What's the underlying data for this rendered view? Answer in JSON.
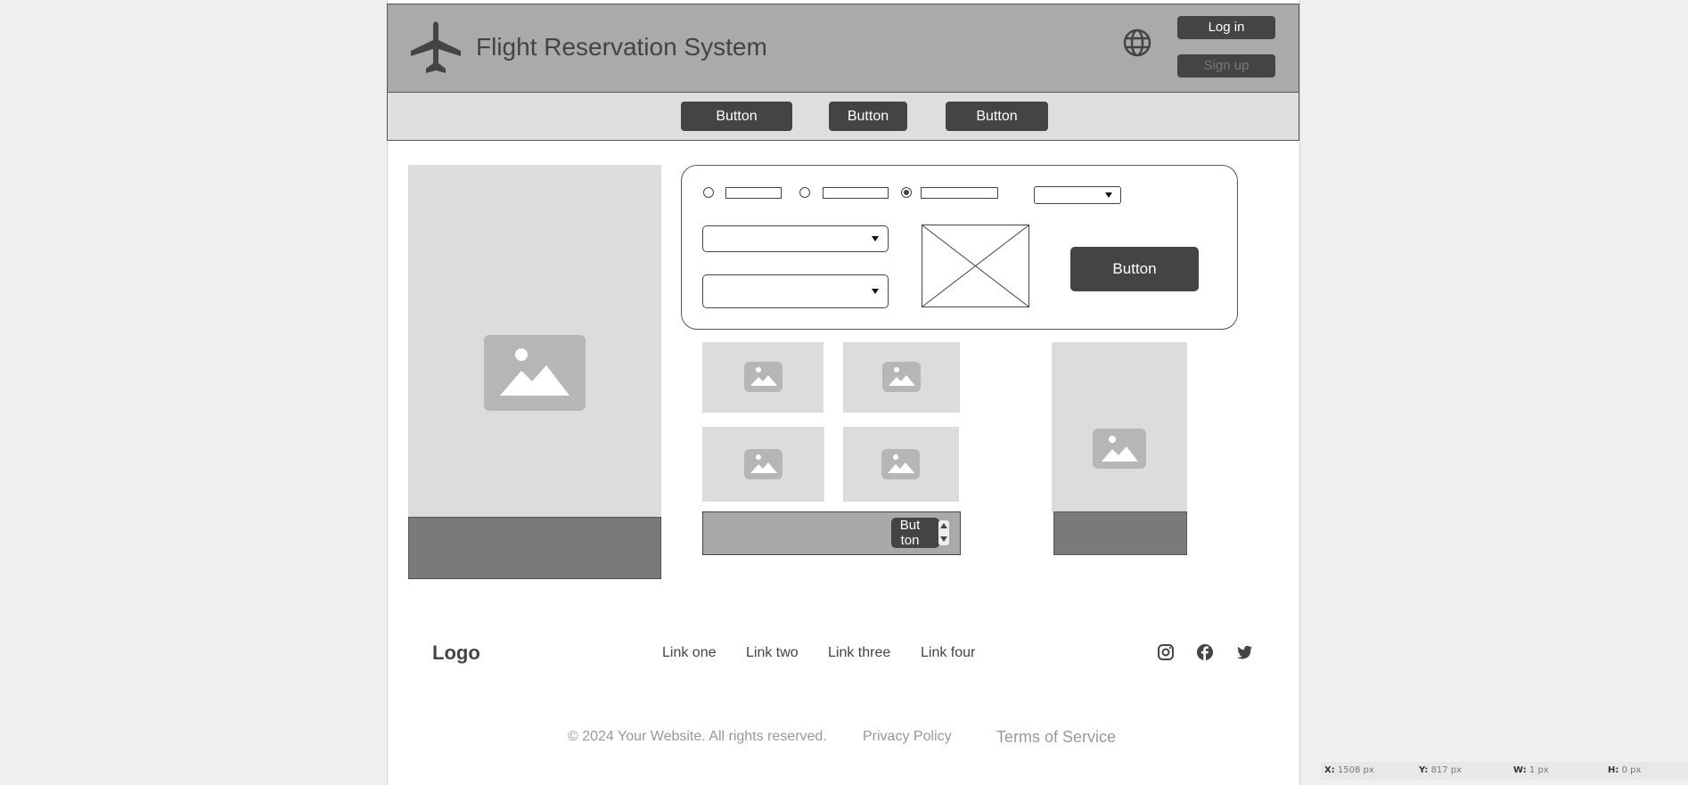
{
  "header": {
    "title": "Flight Reservation System",
    "login_label": "Log in",
    "signup_label": "Sign up"
  },
  "nav": {
    "buttons": [
      "Button",
      "Button",
      "Button"
    ]
  },
  "search_form": {
    "submit_label": "Button"
  },
  "gallery": {
    "step_button_label_1": "But",
    "step_button_label_2": "ton"
  },
  "footer": {
    "logo": "Logo",
    "links": [
      "Link one",
      "Link two",
      "Link three",
      "Link four"
    ],
    "copyright": "© 2024 Your Website. All rights reserved.",
    "privacy": "Privacy Policy",
    "terms": "Terms of Service"
  },
  "status_bar": {
    "x_label": "X:",
    "x_value": "1508 px",
    "y_label": "Y:",
    "y_value": "817 px",
    "w_label": "W:",
    "w_value": "1 px",
    "h_label": "H:",
    "h_value": "0 px"
  },
  "icons": {
    "brand": "airplane-icon",
    "language": "globe-icon",
    "image_placeholder": "image-icon",
    "social": [
      "instagram-icon",
      "facebook-icon",
      "twitter-icon"
    ]
  },
  "colors": {
    "header_bg": "#aaaaaa",
    "nav_bg": "#dedede",
    "button_bg": "#444444",
    "placeholder_bg": "#dcdcdc",
    "bar_dark": "#7a7a7a"
  }
}
